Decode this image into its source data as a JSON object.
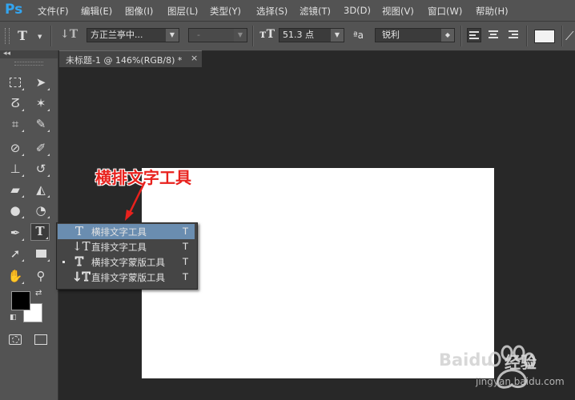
{
  "app": {
    "logo": "Ps"
  },
  "menu": [
    "文件(F)",
    "编辑(E)",
    "图像(I)",
    "图层(L)",
    "类型(Y)",
    "选择(S)",
    "滤镜(T)",
    "3D(D)",
    "视图(V)",
    "窗口(W)",
    "帮助(H)"
  ],
  "options": {
    "font_family": "方正兰亭中...",
    "font_style": "-",
    "font_size": "51.3 点",
    "antialias_icon": "ªa",
    "antialias": "锐利",
    "color_swatch": "#f2f2f2"
  },
  "document_tab": {
    "title": "未标题-1 @ 146%(RGB/8) *",
    "close": "×"
  },
  "flyout": {
    "items": [
      {
        "label": "横排文字工具",
        "key": "T",
        "icon": "T"
      },
      {
        "label": "直排文字工具",
        "key": "T",
        "icon": "↓T"
      },
      {
        "label": "横排文字蒙版工具",
        "key": "T",
        "icon": "T"
      },
      {
        "label": "直排文字蒙版工具",
        "key": "T",
        "icon": "↓T"
      }
    ]
  },
  "annotation": {
    "text": "横排文字工具",
    "color": "#e8211d"
  },
  "watermark": {
    "brand": "Baidu",
    "brand2": "经验",
    "url": "jingyan.baidu.com"
  },
  "colors": {
    "foreground": "#000000",
    "background": "#ffffff"
  }
}
